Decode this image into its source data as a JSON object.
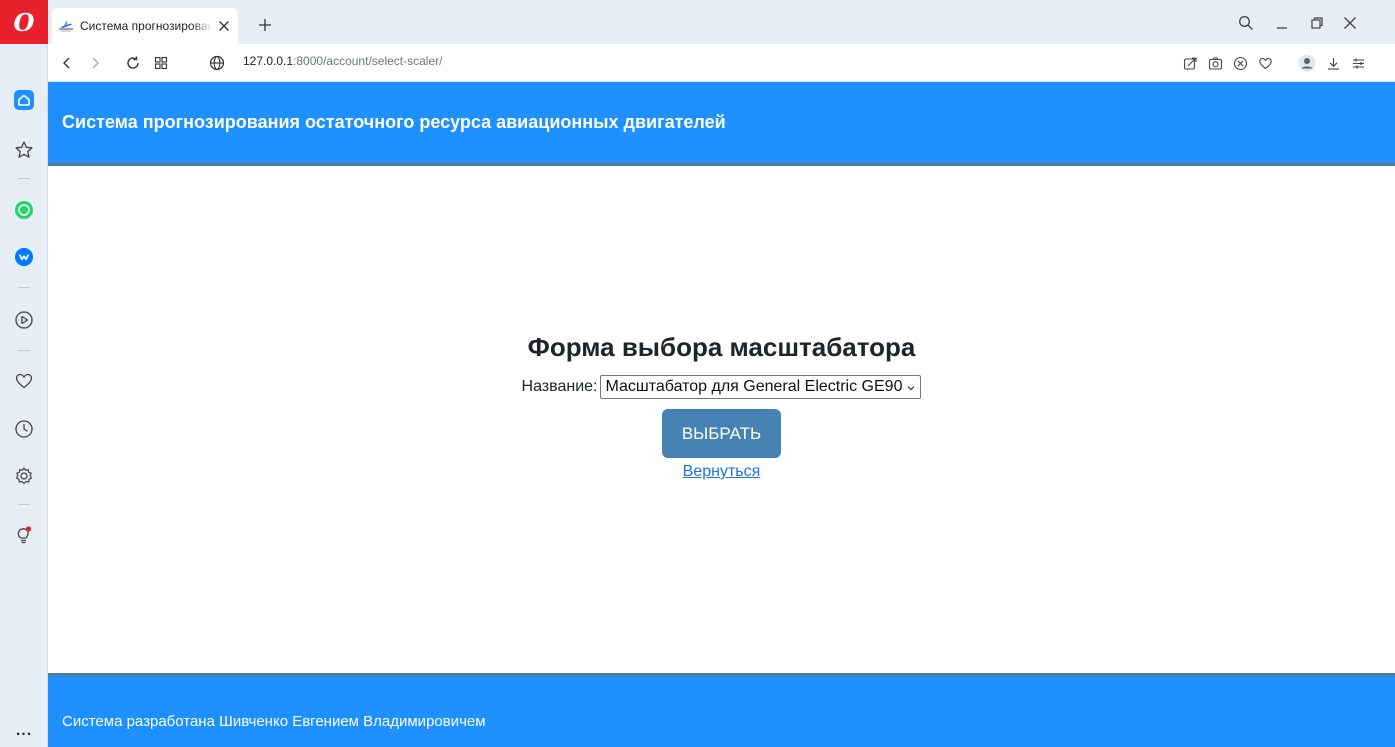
{
  "browser": {
    "tab": {
      "title": "Система прогнозирования остаточного ресурса",
      "favicon": "plane-icon"
    },
    "url": {
      "host": "127.0.0.1",
      "path": ":8000/account/select-scaler/"
    }
  },
  "colors": {
    "header_bg": "#1e90ff",
    "button_bg": "#4682b4",
    "link": "#1a73e8",
    "brand": "#e8222d"
  },
  "header": {
    "title": "Система прогнозирования остаточного ресурса авиационных двигателей"
  },
  "form": {
    "title": "Форма выбора масштабатора",
    "name_label": "Название:",
    "selected_scaler": "Масштабатор для General Electric GE90",
    "submit_label": "ВЫБРАТЬ",
    "back_link": "Вернуться"
  },
  "footer": {
    "text": "Система разработана Шивченко Евгением Владимировичем"
  },
  "sidebar": {
    "more_label": "..."
  }
}
